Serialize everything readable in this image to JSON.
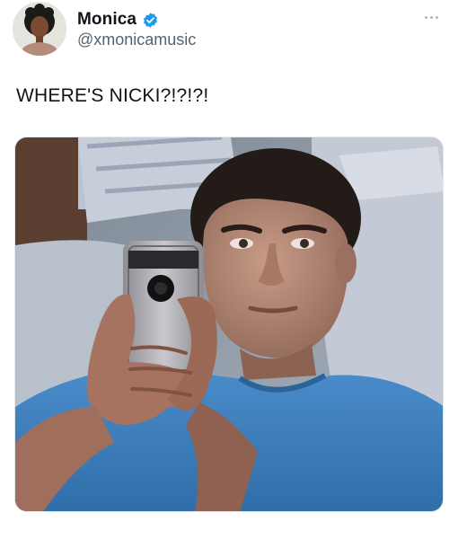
{
  "tweet": {
    "author": {
      "display_name": "Monica",
      "handle": "@xmonicamusic",
      "verified": true,
      "avatar_icon": "profile-photo"
    },
    "more_icon": "more-horizontal-icon",
    "text": "WHERE'S NICKI?!?!?!",
    "media": {
      "type": "photo",
      "description_icon": "meme-photo-man-on-phone-in-bed"
    }
  },
  "colors": {
    "verified_badge": "#1d9bf0",
    "text_primary": "#0f1419",
    "text_secondary": "#536471",
    "shirt_blue": "#3d86c6"
  }
}
